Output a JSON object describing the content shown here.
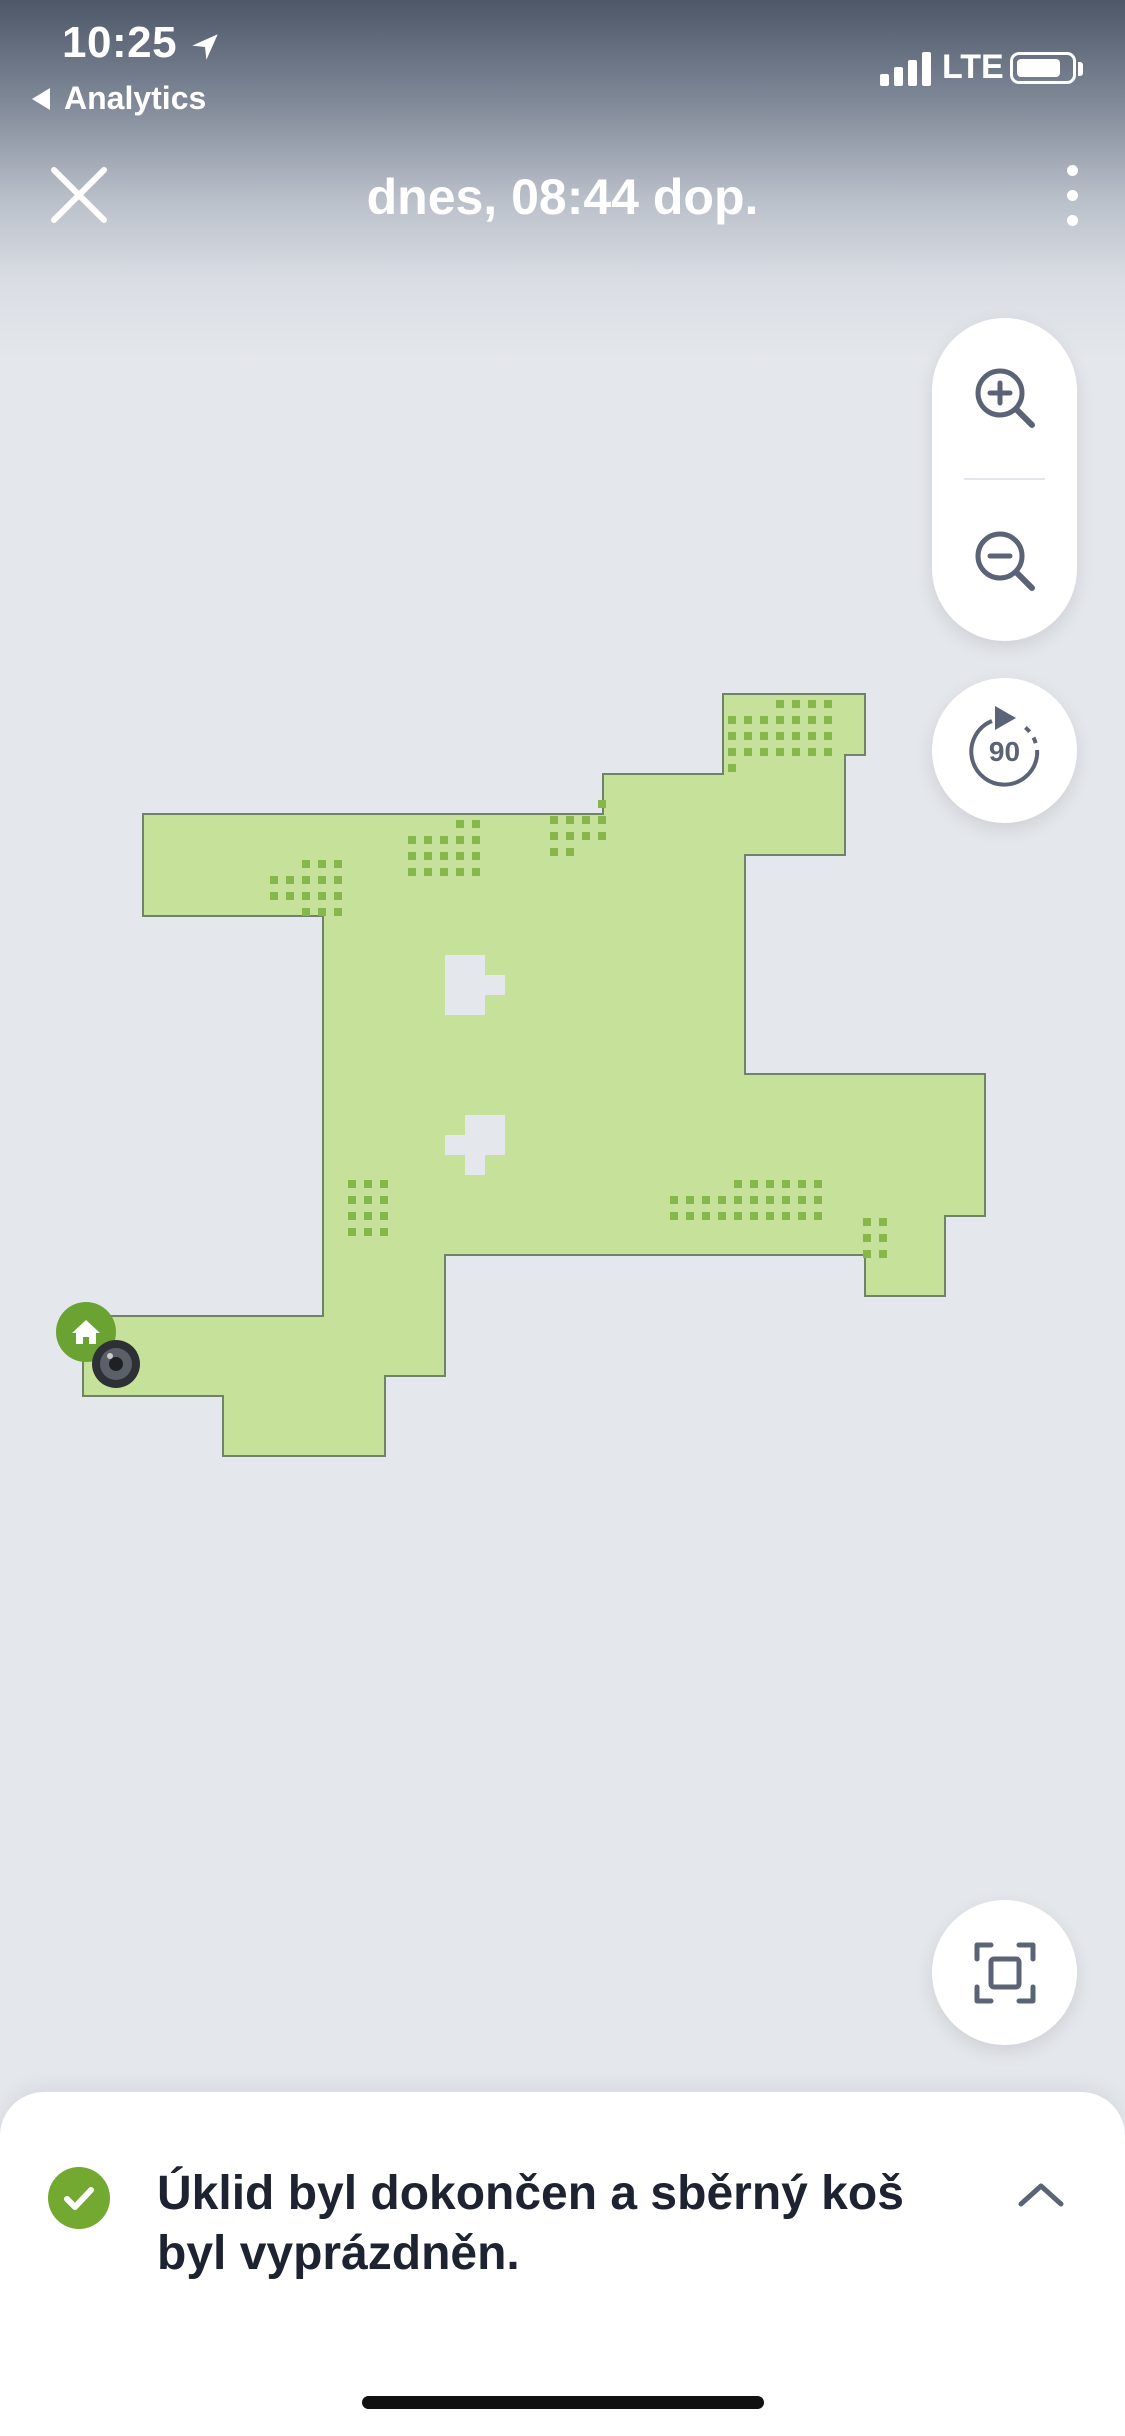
{
  "status_bar": {
    "time": "10:25",
    "back_app": "Analytics",
    "network": "LTE",
    "battery_level": 0.8,
    "icons": [
      "location-arrow-icon",
      "signal-icon",
      "battery-icon"
    ]
  },
  "nav": {
    "title": "dnes, 08:44 dop.",
    "icons": [
      "close-icon",
      "more-vertical-icon"
    ]
  },
  "map": {
    "floor_color": "#c5e19a",
    "dirt_color": "#86b74a",
    "obstacle_color": "#e4e7ec",
    "dock_color": "#6aa332",
    "icons": [
      "home-icon",
      "robot-icon"
    ]
  },
  "controls": {
    "rotate_label": "90",
    "icons": [
      "zoom-in-icon",
      "zoom-out-icon",
      "rotate-icon",
      "fit-to-screen-icon"
    ]
  },
  "notification": {
    "message": "Úklid byl dokončen a sběrný koš byl vyprázdněn.",
    "status_color": "#73a831",
    "icons": [
      "check-icon",
      "chevron-up-icon"
    ]
  }
}
